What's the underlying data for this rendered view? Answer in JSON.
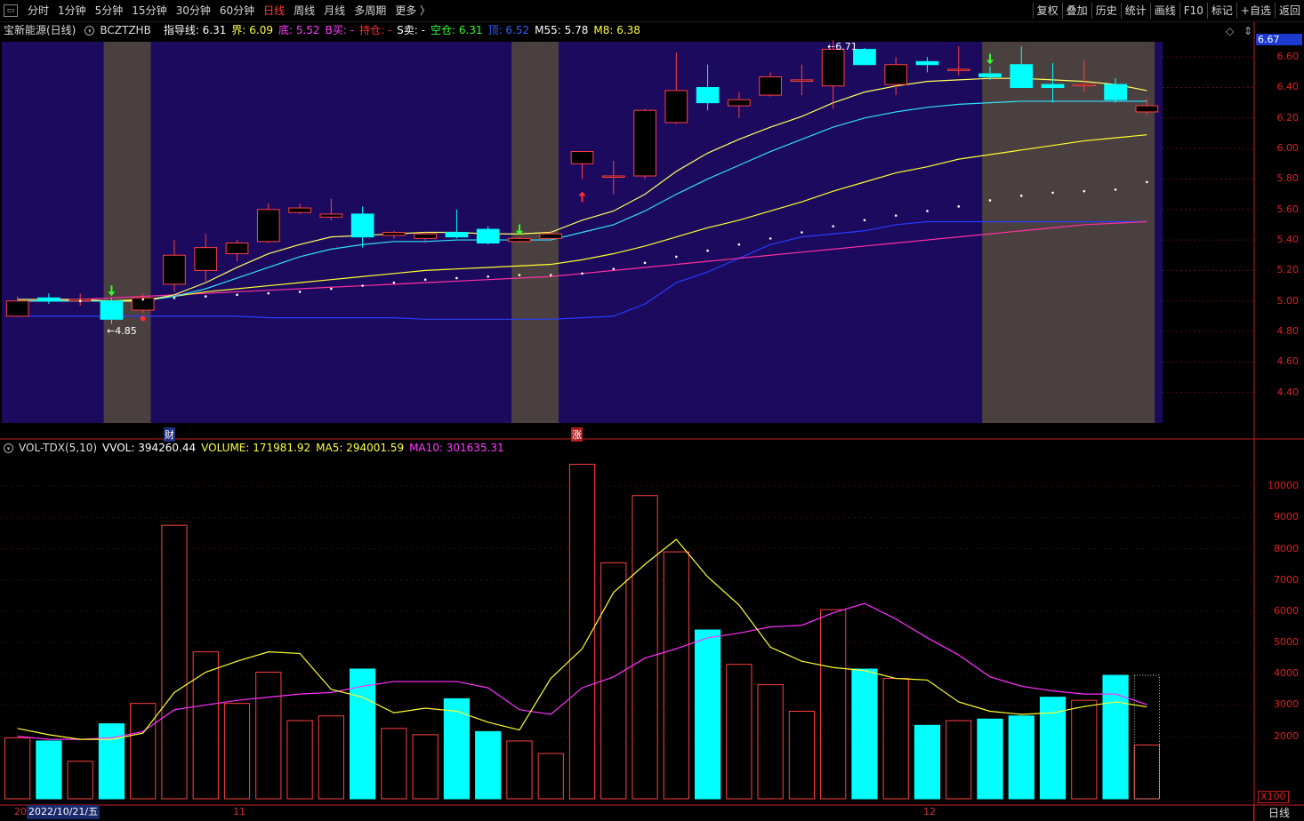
{
  "toolbar": {
    "periods": [
      "分时",
      "1分钟",
      "5分钟",
      "15分钟",
      "30分钟",
      "60分钟",
      "日线",
      "周线",
      "月线",
      "多周期",
      "更多 〉"
    ],
    "active": "日线",
    "right_buttons": [
      "复权",
      "叠加",
      "历史",
      "统计",
      "画线",
      "F10",
      "+自选",
      "返回"
    ],
    "right_special": "标记"
  },
  "main_info": {
    "stock": "宝新能源(日线)",
    "code": "BCZTZHB",
    "items": [
      {
        "label": "指导线: 6.31",
        "color": "#ffffff"
      },
      {
        "label": "界: 6.09",
        "color": "#ffff40"
      },
      {
        "label": "底: 5.52",
        "color": "#ff3cff"
      },
      {
        "label": "B买: -",
        "color": "#ff3cff"
      },
      {
        "label": "持仓: -",
        "color": "#ff3030"
      },
      {
        "label": "S卖: -",
        "color": "#ffffff"
      },
      {
        "label": "空仓: 6.31",
        "color": "#30ff30"
      },
      {
        "label": "顶: 6.52",
        "color": "#3060ff"
      },
      {
        "label": "M55: 5.78",
        "color": "#ffffff"
      },
      {
        "label": "M8: 6.38",
        "color": "#ffff40"
      }
    ],
    "ctrl_diamond": "◇",
    "ctrl_arrow": "⇕"
  },
  "price_axis": {
    "current": "6.67",
    "labels": [
      "6.60",
      "6.40",
      "6.20",
      "6.00",
      "5.80",
      "5.60",
      "5.40",
      "5.20",
      "5.00",
      "4.80",
      "4.60",
      "4.40"
    ]
  },
  "annotations": {
    "high": "6.71",
    "low": "4.85",
    "cai": "财",
    "zhang": "涨"
  },
  "vol_info": {
    "name": "VOL-TDX(5,10)",
    "items": [
      {
        "label": "VVOL: 394260.44",
        "color": "#ffffff"
      },
      {
        "label": "VOLUME: 171981.92",
        "color": "#ffff40"
      },
      {
        "label": "MA5: 294001.59",
        "color": "#ffff40"
      },
      {
        "label": "MA10: 301635.31",
        "color": "#ff3cff"
      }
    ]
  },
  "vol_axis": {
    "labels": [
      "10000",
      "9000",
      "8000",
      "7000",
      "6000",
      "5000",
      "4000",
      "3000",
      "2000"
    ],
    "unit": "X100"
  },
  "dates": {
    "start": "20",
    "current": "2022/10/21/五",
    "m11": "11",
    "m12": "12"
  },
  "corner": "日线",
  "colors": {
    "up": "#ff4040",
    "down": "#00ffff",
    "bg_main": "#1c0a5e",
    "bg_shade": "#4b4040",
    "axis": "#c02020"
  },
  "chart_data": {
    "type": "candlestick",
    "candles": [
      {
        "o": 4.9,
        "h": 5.03,
        "l": 4.9,
        "c": 5.0
      },
      {
        "o": 5.02,
        "h": 5.05,
        "l": 4.98,
        "c": 5.0
      },
      {
        "o": 5.0,
        "h": 5.05,
        "l": 4.97,
        "c": 5.01
      },
      {
        "o": 5.0,
        "h": 5.02,
        "l": 4.85,
        "c": 4.88
      },
      {
        "o": 4.94,
        "h": 5.05,
        "l": 4.92,
        "c": 5.02
      },
      {
        "o": 5.11,
        "h": 5.4,
        "l": 5.06,
        "c": 5.3
      },
      {
        "o": 5.2,
        "h": 5.44,
        "l": 5.13,
        "c": 5.35
      },
      {
        "o": 5.31,
        "h": 5.4,
        "l": 5.26,
        "c": 5.38
      },
      {
        "o": 5.39,
        "h": 5.64,
        "l": 5.38,
        "c": 5.6
      },
      {
        "o": 5.58,
        "h": 5.64,
        "l": 5.57,
        "c": 5.61
      },
      {
        "o": 5.55,
        "h": 5.67,
        "l": 5.53,
        "c": 5.57
      },
      {
        "o": 5.57,
        "h": 5.62,
        "l": 5.35,
        "c": 5.42
      },
      {
        "o": 5.43,
        "h": 5.46,
        "l": 5.41,
        "c": 5.45
      },
      {
        "o": 5.41,
        "h": 5.45,
        "l": 5.38,
        "c": 5.44
      },
      {
        "o": 5.45,
        "h": 5.6,
        "l": 5.41,
        "c": 5.42
      },
      {
        "o": 5.47,
        "h": 5.49,
        "l": 5.37,
        "c": 5.38
      },
      {
        "o": 5.39,
        "h": 5.42,
        "l": 5.38,
        "c": 5.41
      },
      {
        "o": 5.41,
        "h": 5.46,
        "l": 5.4,
        "c": 5.44
      },
      {
        "o": 5.9,
        "h": 5.98,
        "l": 5.8,
        "c": 5.98
      },
      {
        "o": 5.82,
        "h": 5.92,
        "l": 5.7,
        "c": 5.82
      },
      {
        "o": 5.82,
        "h": 6.26,
        "l": 5.8,
        "c": 6.25
      },
      {
        "o": 6.17,
        "h": 6.63,
        "l": 6.16,
        "c": 6.38
      },
      {
        "o": 6.4,
        "h": 6.55,
        "l": 6.25,
        "c": 6.3
      },
      {
        "o": 6.28,
        "h": 6.37,
        "l": 6.2,
        "c": 6.32
      },
      {
        "o": 6.35,
        "h": 6.5,
        "l": 6.34,
        "c": 6.47
      },
      {
        "o": 6.45,
        "h": 6.55,
        "l": 6.35,
        "c": 6.45
      },
      {
        "o": 6.41,
        "h": 6.71,
        "l": 6.26,
        "c": 6.65
      },
      {
        "o": 6.65,
        "h": 6.66,
        "l": 6.55,
        "c": 6.55
      },
      {
        "o": 6.42,
        "h": 6.6,
        "l": 6.35,
        "c": 6.55
      },
      {
        "o": 6.57,
        "h": 6.6,
        "l": 6.5,
        "c": 6.55
      },
      {
        "o": 6.52,
        "h": 6.67,
        "l": 6.48,
        "c": 6.52
      },
      {
        "o": 6.49,
        "h": 6.54,
        "l": 6.45,
        "c": 6.47
      },
      {
        "o": 6.55,
        "h": 6.67,
        "l": 6.4,
        "c": 6.4
      },
      {
        "o": 6.42,
        "h": 6.56,
        "l": 6.3,
        "c": 6.4
      },
      {
        "o": 6.42,
        "h": 6.58,
        "l": 6.37,
        "c": 6.42
      },
      {
        "o": 6.42,
        "h": 6.46,
        "l": 6.3,
        "c": 6.32
      },
      {
        "o": 6.24,
        "h": 6.33,
        "l": 6.22,
        "c": 6.28
      }
    ],
    "volume": [
      1950,
      1850,
      1200,
      2400,
      3050,
      8750,
      4700,
      3050,
      4050,
      2500,
      2650,
      4150,
      2250,
      2050,
      3200,
      2150,
      1850,
      1450,
      10700,
      7550,
      9700,
      7900,
      5400,
      4300,
      3650,
      2800,
      6050,
      4150,
      3850,
      2350,
      2500,
      2550,
      2650,
      3250,
      3150,
      3950,
      1720
    ],
    "lines": {
      "guide_white": [
        5.02,
        5.03,
        5.03,
        5.02,
        5.03,
        5.04,
        5.05,
        5.06,
        5.07,
        5.09,
        5.12,
        5.13,
        5.14,
        5.16,
        5.17,
        5.19,
        5.2,
        5.21,
        5.23,
        5.26,
        5.3,
        5.35,
        5.4,
        5.45,
        5.49,
        5.52,
        5.56,
        5.6,
        5.62,
        5.64,
        5.66,
        5.68,
        5.7,
        5.72,
        5.74,
        5.76,
        5.78
      ],
      "blue_top": [
        4.9,
        4.9,
        4.9,
        4.9,
        4.9,
        4.9,
        4.9,
        4.9,
        4.89,
        4.89,
        4.89,
        4.89,
        4.89,
        4.88,
        4.88,
        4.88,
        4.88,
        4.88,
        4.89,
        4.9,
        4.98,
        5.12,
        5.19,
        5.28,
        5.37,
        5.42,
        5.44,
        5.46,
        5.5,
        5.52,
        5.52,
        5.52,
        5.52,
        5.52,
        5.52,
        5.52,
        5.52
      ],
      "yellow_m8": [
        5.01,
        5.01,
        5.01,
        5.0,
        5.0,
        5.04,
        5.12,
        5.22,
        5.31,
        5.37,
        5.42,
        5.43,
        5.44,
        5.45,
        5.45,
        5.44,
        5.44,
        5.45,
        5.53,
        5.59,
        5.7,
        5.85,
        5.97,
        6.06,
        6.14,
        6.21,
        6.3,
        6.37,
        6.41,
        6.44,
        6.45,
        6.46,
        6.46,
        6.45,
        6.44,
        6.42,
        6.38
      ],
      "cyan": [
        5.0,
        5.0,
        5.0,
        5.0,
        5.0,
        5.03,
        5.08,
        5.15,
        5.22,
        5.29,
        5.34,
        5.37,
        5.39,
        5.39,
        5.4,
        5.4,
        5.4,
        5.4,
        5.45,
        5.5,
        5.59,
        5.7,
        5.8,
        5.89,
        5.98,
        6.06,
        6.14,
        6.2,
        6.24,
        6.27,
        6.29,
        6.3,
        6.31,
        6.31,
        6.31,
        6.31,
        6.31
      ],
      "yellow_low": [
        5.0,
        5.0,
        5.0,
        5.0,
        5.01,
        5.03,
        5.06,
        5.08,
        5.1,
        5.12,
        5.14,
        5.16,
        5.18,
        5.2,
        5.21,
        5.22,
        5.23,
        5.24,
        5.27,
        5.31,
        5.36,
        5.42,
        5.48,
        5.53,
        5.59,
        5.65,
        5.72,
        5.78,
        5.84,
        5.88,
        5.93,
        5.96,
        5.99,
        6.02,
        6.05,
        6.07,
        6.09
      ],
      "magenta_bottom": [
        5.0,
        5.0,
        5.01,
        5.02,
        5.03,
        5.04,
        5.05,
        5.06,
        5.07,
        5.08,
        5.09,
        5.1,
        5.11,
        5.12,
        5.13,
        5.14,
        5.15,
        5.16,
        5.18,
        5.2,
        5.22,
        5.24,
        5.26,
        5.28,
        5.3,
        5.32,
        5.34,
        5.36,
        5.38,
        5.4,
        5.42,
        5.44,
        5.46,
        5.48,
        5.5,
        5.51,
        5.52
      ],
      "vol_ma5": [
        2250,
        2050,
        1900,
        1900,
        2100,
        3400,
        4050,
        4400,
        4700,
        4650,
        3500,
        3250,
        2750,
        2900,
        2800,
        2450,
        2200,
        3850,
        4800,
        6600,
        7500,
        8300,
        7100,
        6200,
        4850,
        4400,
        4200,
        4100,
        3850,
        3800,
        3100,
        2800,
        2700,
        2750,
        2950,
        3100,
        2940
      ],
      "vol_ma10": [
        2000,
        1900,
        1900,
        1950,
        2150,
        2850,
        3000,
        3150,
        3250,
        3350,
        3400,
        3600,
        3750,
        3750,
        3750,
        3550,
        2850,
        2700,
        3550,
        3900,
        4500,
        4800,
        5150,
        5300,
        5500,
        5550,
        5950,
        6250,
        5750,
        5150,
        4600,
        3900,
        3600,
        3450,
        3350,
        3350,
        3016
      ]
    },
    "dots": [
      null,
      null,
      5.0,
      null,
      5.01,
      5.02,
      5.03,
      5.04,
      5.05,
      5.06,
      5.08,
      5.1,
      5.12,
      5.14,
      5.15,
      5.16,
      5.17,
      5.17,
      5.18,
      5.21,
      5.25,
      5.29,
      5.33,
      5.37,
      5.41,
      5.45,
      5.49,
      5.53,
      5.56,
      5.59,
      5.62,
      5.66,
      5.69,
      5.71,
      5.72,
      5.73,
      5.78
    ],
    "signals": {
      "buy_green": [
        3,
        16,
        31
      ],
      "red_up": [
        18
      ],
      "red_small": [
        4
      ]
    },
    "shaded_bands": [
      [
        3,
        4
      ],
      [
        16,
        17
      ],
      [
        31,
        36
      ]
    ],
    "price_range": [
      4.2,
      6.7
    ],
    "vol_range": [
      0,
      11000
    ]
  }
}
